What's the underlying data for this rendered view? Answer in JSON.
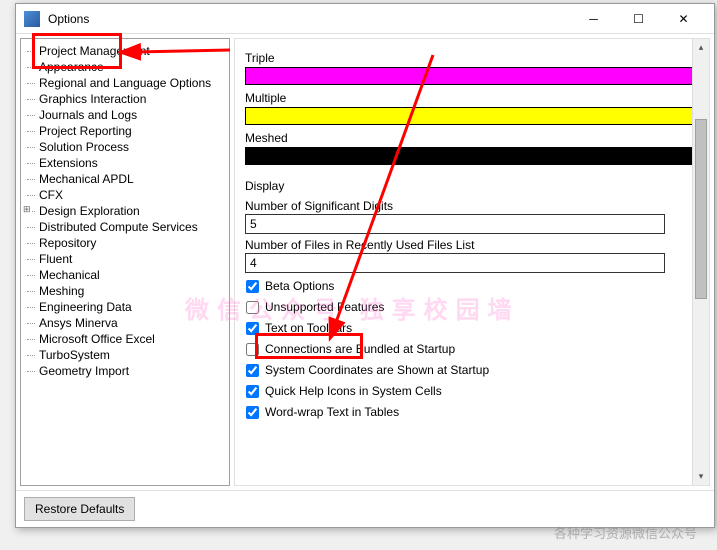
{
  "window": {
    "title": "Options"
  },
  "tree": {
    "items": [
      "Project Management",
      "Appearance",
      "Regional and Language Options",
      "Graphics Interaction",
      "Journals and Logs",
      "Project Reporting",
      "Solution Process",
      "Extensions",
      "Mechanical APDL",
      "CFX",
      "Design Exploration",
      "Distributed Compute Services",
      "Repository",
      "Fluent",
      "Mechanical",
      "Meshing",
      "Engineering Data",
      "Ansys Minerva",
      "Microsoft Office Excel",
      "TurboSystem",
      "Geometry Import"
    ]
  },
  "colors": {
    "triple_label": "Triple",
    "multiple_label": "Multiple",
    "meshed_label": "Meshed"
  },
  "display": {
    "section": "Display",
    "digits_label": "Number of Significant Digits",
    "digits_value": "5",
    "recent_label": "Number of Files in Recently Used Files List",
    "recent_value": "4"
  },
  "checks": {
    "beta": {
      "label": "Beta Options",
      "checked": true
    },
    "unsupported": {
      "label": "Unsupported Features",
      "checked": false
    },
    "toolbars": {
      "label": "Text on Toolbars",
      "checked": true
    },
    "connections": {
      "label": "Connections are Bundled at Startup",
      "checked": false
    },
    "coords": {
      "label": "System Coordinates are Shown at Startup",
      "checked": true
    },
    "quickhelp": {
      "label": "Quick Help Icons in System Cells",
      "checked": true
    },
    "wordwrap": {
      "label": "Word-wrap Text in Tables",
      "checked": true
    }
  },
  "footer": {
    "restore": "Restore Defaults"
  },
  "watermark": "各种学习资源微信公众号"
}
